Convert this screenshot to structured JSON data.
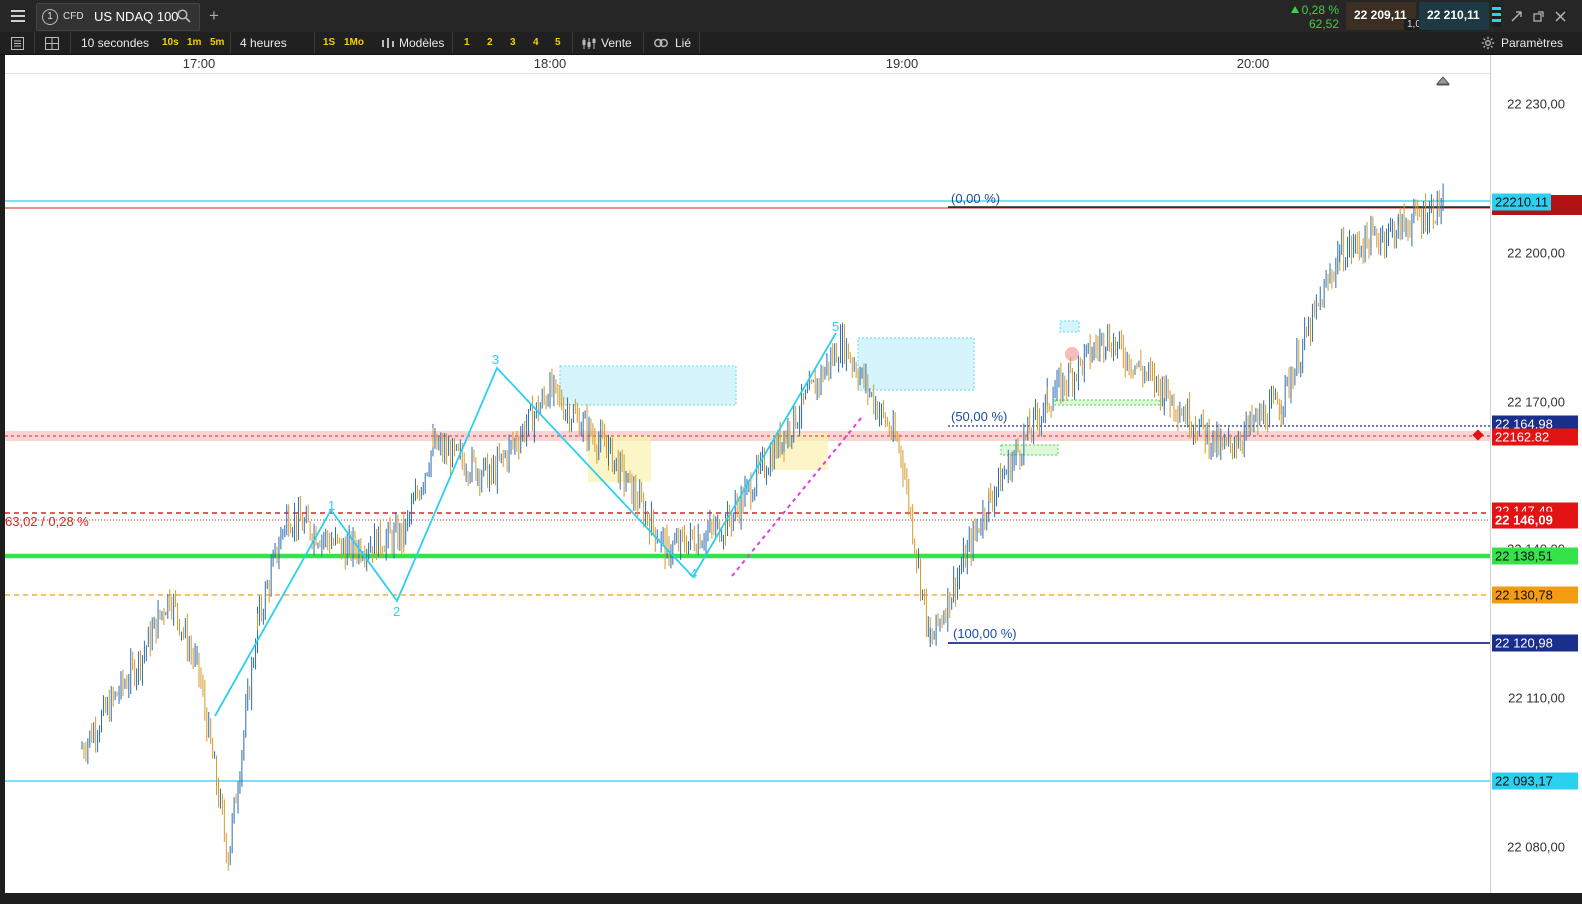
{
  "topbar": {
    "menu_icon": "hamburger-icon",
    "workspace_number": "1",
    "instrument_type": "CFD",
    "instrument_name": "US NDAQ 100",
    "change_percent": "0,28 %",
    "change_points": "62,52",
    "bid": "22 209,11",
    "ask": "22 210,11",
    "spread": "1,00"
  },
  "toolbar": {
    "interval": "10 secondes",
    "quick_intervals": [
      "10s",
      "1m",
      "5m"
    ],
    "range": "4 heures",
    "quick_ranges": [
      "1S",
      "1Mo"
    ],
    "models": "Modèles",
    "slots": [
      "1",
      "2",
      "3",
      "4",
      "5"
    ],
    "sell": "Vente",
    "linked": "Lié",
    "settings": "Paramètres"
  },
  "chart": {
    "time_labels": [
      "17:00",
      "18:00",
      "19:00",
      "20:00"
    ],
    "price_labels": [
      "22 230,00",
      "22 200,00",
      "22 170,00",
      "22 110,00",
      "22 080,00"
    ],
    "price_boxes": {
      "current": "22210.11",
      "fib_50": "22 164,98",
      "red_zone": "22162.82",
      "red_dashed": "22 147,49",
      "red_order": "22 146,09",
      "hidden_label": "22 140,00",
      "green": "22 138,51",
      "orange": "22 130,78",
      "fib_100": "22 120,98",
      "cyan_low": "22 093,17"
    },
    "fib_labels": {
      "top": "(0,00 %)",
      "mid": "(50,00 %)",
      "bottom": "(100,00 %)"
    },
    "position_label": "63,02 / 0,28 %",
    "wave_labels": [
      "1",
      "2",
      "3",
      "4",
      "5"
    ],
    "colors": {
      "cyan": "#2ad0f0",
      "green": "#34e34a",
      "red": "#e02424",
      "orange": "#f39c12",
      "navy": "#1a2e8c",
      "bar_up": "#2b6cb0",
      "bar_down": "#d69a2a"
    }
  },
  "chart_data": {
    "type": "candlestick",
    "x_range": [
      "16:40",
      "20:35"
    ],
    "ylim": [
      22070,
      22245
    ],
    "series_approx": [
      {
        "time": "16:40",
        "price": 22100
      },
      {
        "time": "16:50",
        "price": 22118
      },
      {
        "time": "16:55",
        "price": 22131
      },
      {
        "time": "17:00",
        "price": 22115
      },
      {
        "time": "17:05",
        "price": 22078
      },
      {
        "time": "17:10",
        "price": 22125
      },
      {
        "time": "17:15",
        "price": 22147
      },
      {
        "time": "17:25",
        "price": 22140
      },
      {
        "time": "17:35",
        "price": 22143
      },
      {
        "time": "17:40",
        "price": 22161
      },
      {
        "time": "17:50",
        "price": 22155
      },
      {
        "time": "18:00",
        "price": 22172
      },
      {
        "time": "18:10",
        "price": 22160
      },
      {
        "time": "18:20",
        "price": 22140
      },
      {
        "time": "18:30",
        "price": 22145
      },
      {
        "time": "18:40",
        "price": 22163
      },
      {
        "time": "18:50",
        "price": 22182
      },
      {
        "time": "19:00",
        "price": 22160
      },
      {
        "time": "19:05",
        "price": 22121
      },
      {
        "time": "19:15",
        "price": 22150
      },
      {
        "time": "19:25",
        "price": 22170
      },
      {
        "time": "19:35",
        "price": 22183
      },
      {
        "time": "19:45",
        "price": 22172
      },
      {
        "time": "19:55",
        "price": 22160
      },
      {
        "time": "20:05",
        "price": 22170
      },
      {
        "time": "20:15",
        "price": 22200
      },
      {
        "time": "20:25",
        "price": 22205
      },
      {
        "time": "20:33",
        "price": 22210
      }
    ]
  }
}
